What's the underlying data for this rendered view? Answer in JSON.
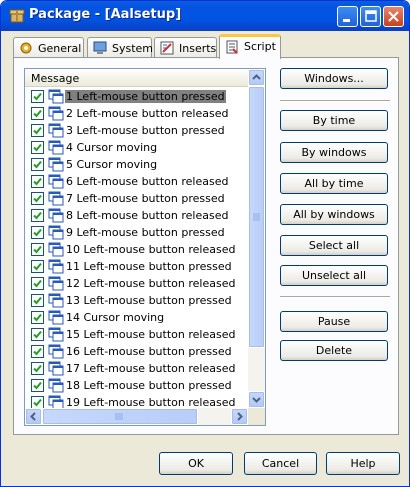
{
  "window": {
    "title": "Package - [Aalsetup]"
  },
  "tabs": [
    {
      "label": "General",
      "icon": "gear-icon"
    },
    {
      "label": "System",
      "icon": "computer-icon"
    },
    {
      "label": "Inserts",
      "icon": "inserts-icon"
    },
    {
      "label": "Script",
      "icon": "script-icon",
      "active": true
    }
  ],
  "list": {
    "header": "Message",
    "rows": [
      {
        "text": "1 Left-mouse button pressed",
        "checked": true,
        "selected": true
      },
      {
        "text": "2 Left-mouse button released",
        "checked": true
      },
      {
        "text": "3 Left-mouse button pressed",
        "checked": true
      },
      {
        "text": "4 Cursor moving",
        "checked": true
      },
      {
        "text": "5 Cursor moving",
        "checked": true
      },
      {
        "text": "6 Left-mouse button released",
        "checked": true
      },
      {
        "text": "7 Left-mouse button pressed",
        "checked": true
      },
      {
        "text": "8 Left-mouse button released",
        "checked": true
      },
      {
        "text": "9 Left-mouse button pressed",
        "checked": true
      },
      {
        "text": "10 Left-mouse button released",
        "checked": true
      },
      {
        "text": "11 Left-mouse button pressed",
        "checked": true
      },
      {
        "text": "12 Left-mouse button released",
        "checked": true
      },
      {
        "text": "13 Left-mouse button pressed",
        "checked": true
      },
      {
        "text": "14 Cursor moving",
        "checked": true
      },
      {
        "text": "15 Left-mouse button released",
        "checked": true
      },
      {
        "text": "16 Left-mouse button pressed",
        "checked": true
      },
      {
        "text": "17 Left-mouse button released",
        "checked": true
      },
      {
        "text": "18 Left-mouse button pressed",
        "checked": true
      },
      {
        "text": "19 Left-mouse button released",
        "checked": true
      }
    ]
  },
  "side_buttons": {
    "windows": "Windows...",
    "by_time": "By time",
    "by_windows": "By windows",
    "all_by_time": "All by time",
    "all_by_windows": "All by windows",
    "select_all": "Select all",
    "unselect_all": "Unselect all",
    "pause": "Pause",
    "delete": "Delete"
  },
  "footer": {
    "ok": "OK",
    "cancel": "Cancel",
    "help": "Help"
  },
  "colors": {
    "titlebar": "#0054e3",
    "face": "#ece9d8",
    "selection": "#808080",
    "checkmark": "#21a121"
  }
}
